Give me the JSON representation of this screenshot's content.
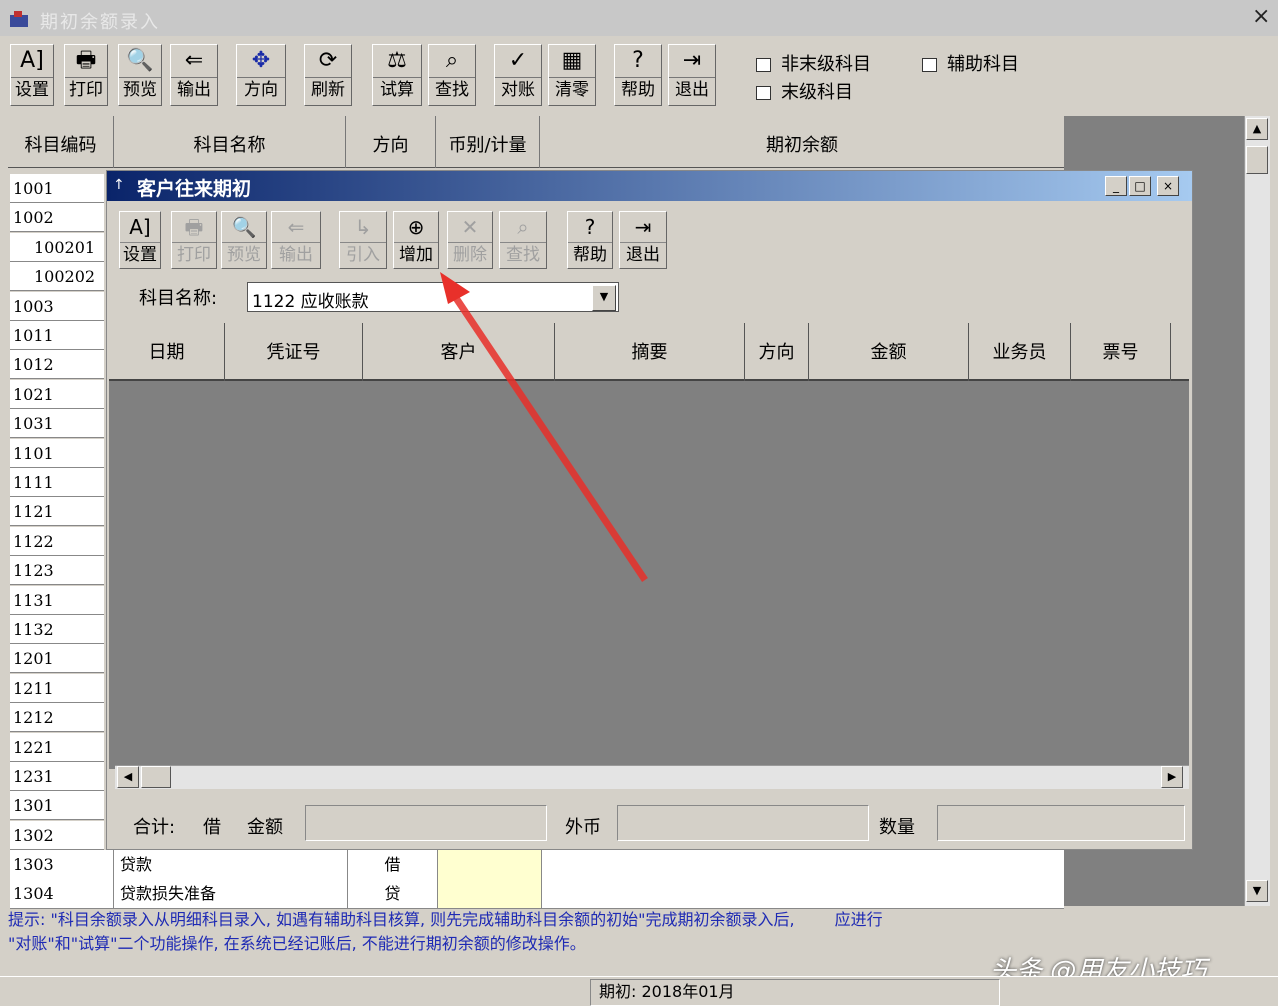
{
  "window": {
    "title": "期初余额录入",
    "close": "×"
  },
  "toolbar": [
    {
      "icon": "A]",
      "label": "设置"
    },
    {
      "icon": "🖶",
      "label": "打印"
    },
    {
      "icon": "🔍",
      "label": "预览"
    },
    {
      "icon": "⇐",
      "label": "输出"
    },
    {
      "icon": "✥",
      "label": "方向"
    },
    {
      "icon": "⟳",
      "label": "刷新"
    },
    {
      "icon": "⚖",
      "label": "试算"
    },
    {
      "icon": "⌕",
      "label": "查找"
    },
    {
      "icon": "✓",
      "label": "对账"
    },
    {
      "icon": "▦",
      "label": "清零"
    },
    {
      "icon": "?",
      "label": "帮助"
    },
    {
      "icon": "⇥",
      "label": "退出"
    }
  ],
  "checkboxes": {
    "non_leaf": "非末级科目",
    "aux": "辅助科目",
    "leaf": "末级科目"
  },
  "grid": {
    "headers": [
      "科目编码",
      "科目名称",
      "方向",
      "币别/计量",
      "期初余额"
    ],
    "codes": [
      "1001",
      "1002",
      "100201",
      "100202",
      "1003",
      "1011",
      "1012",
      "1021",
      "1031",
      "1101",
      "1111",
      "1121",
      "1122",
      "1123",
      "1131",
      "1132",
      "1201",
      "1211",
      "1212",
      "1221",
      "1231",
      "1301",
      "1302"
    ],
    "bottom_rows": [
      {
        "code": "1303",
        "name": "贷款",
        "dir": "借"
      },
      {
        "code": "1304",
        "name": "贷款损失准备",
        "dir": "贷"
      }
    ]
  },
  "dialog": {
    "title": "客户往来期初",
    "window_buttons": [
      "_",
      "□",
      "×"
    ],
    "buttons": [
      {
        "icon": "A]",
        "label": "设置",
        "enabled": true
      },
      {
        "icon": "🖶",
        "label": "打印",
        "enabled": false
      },
      {
        "icon": "🔍",
        "label": "预览",
        "enabled": false
      },
      {
        "icon": "⇐",
        "label": "输出",
        "enabled": false
      },
      {
        "icon": "↳",
        "label": "引入",
        "enabled": false
      },
      {
        "icon": "⊕",
        "label": "增加",
        "enabled": true
      },
      {
        "icon": "✕",
        "label": "删除",
        "enabled": false
      },
      {
        "icon": "⌕",
        "label": "查找",
        "enabled": false
      },
      {
        "icon": "?",
        "label": "帮助",
        "enabled": true
      },
      {
        "icon": "⇥",
        "label": "退出",
        "enabled": true
      }
    ],
    "subject_label": "科目名称:",
    "subject_value": "1122 应收账款",
    "headers": [
      "日期",
      "凭证号",
      "客户",
      "摘要",
      "方向",
      "金额",
      "业务员",
      "票号"
    ],
    "footer": {
      "total": "合计:",
      "dir": "借",
      "amount_label": "金额",
      "foreign": "外币",
      "qty": "数量"
    }
  },
  "hint": {
    "line1": "提示: \"科目余额录入从明细科目录入, 如遇有辅助科目核算, 则先完成辅助科目余额的初始\"完成期初余额录入后,",
    "line1b": "应进行",
    "line2": "\"对账\"和\"试算\"二个功能操作, 在系统已经记账后, 不能进行期初余额的修改操作。"
  },
  "status": {
    "period": "期初: 2018年01月"
  },
  "watermark": "头条 @用友小技巧",
  "colors": {
    "arrow": "#e8302a",
    "title_gradient_start": "#0a246a",
    "hint_text": "#1e2ab4"
  }
}
